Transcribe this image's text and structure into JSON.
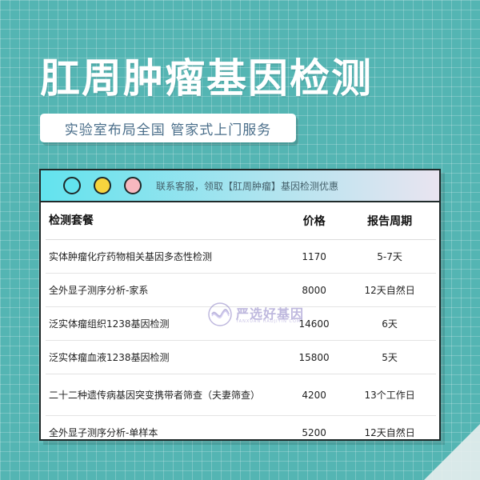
{
  "hero": {
    "title": "肛周肿瘤基因检测",
    "subtitle": "实验室布局全国 管家式上门服务"
  },
  "card": {
    "header_text": "联系客服，领取【肛周肿瘤】基因检测优惠",
    "columns": [
      "检测套餐",
      "价格",
      "报告周期"
    ],
    "rows": [
      {
        "name": "实体肿瘤化疗药物相关基因多态性检测",
        "price": "1170",
        "period": "5-7天"
      },
      {
        "name": "全外显子测序分析-家系",
        "price": "8000",
        "period": "12天自然日"
      },
      {
        "name": "泛实体瘤组织1238基因检测",
        "price": "14600",
        "period": "6天"
      },
      {
        "name": "泛实体瘤血液1238基因检测",
        "price": "15800",
        "period": "5天"
      },
      {
        "name": "二十二种遗传病基因突变携带者筛查（夫妻筛查）",
        "price": "4200",
        "period": "13个工作日"
      },
      {
        "name": "全外显子测序分析-单样本",
        "price": "5200",
        "period": "12天自然日"
      }
    ]
  },
  "watermark": {
    "text": "严选好基因",
    "subtext": "YANXUAN HAOJIYIN COM"
  },
  "colors": {
    "background": "#54b5b3",
    "header_left": "#62e3ee",
    "header_right": "#e9e4f0",
    "dot_cyan": "#62e3ee",
    "dot_yellow": "#f7d43e",
    "dot_pink": "#f7b8bf"
  }
}
